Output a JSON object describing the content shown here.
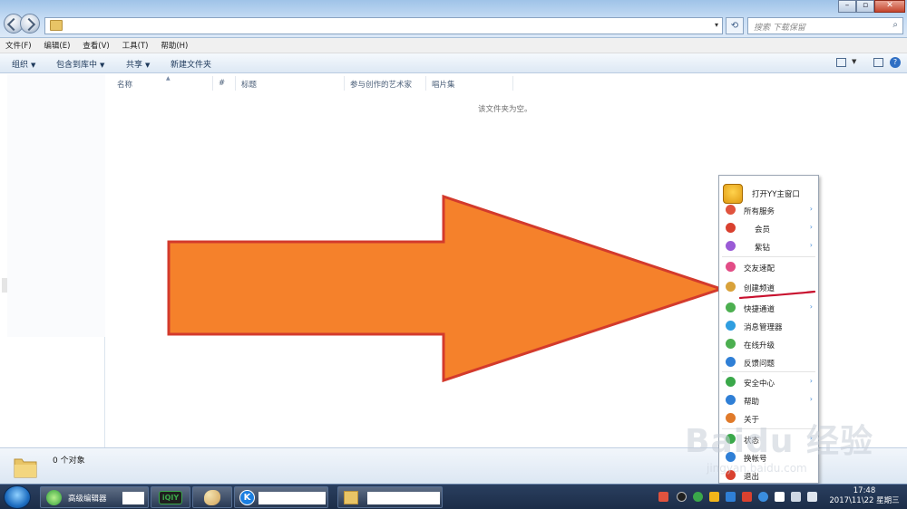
{
  "search": {
    "placeholder": "搜索 下载保留"
  },
  "menubar": {
    "items": [
      "文件(F)",
      "编辑(E)",
      "查看(V)",
      "工具(T)",
      "帮助(H)"
    ]
  },
  "toolbar": {
    "organize": "组织",
    "include_in_library": "包含到库中",
    "share": "共享",
    "new_folder": "新建文件夹"
  },
  "columns": [
    "名称",
    "#",
    "标题",
    "参与创作的艺术家",
    "唱片集"
  ],
  "empty_message": "该文件夹为空。",
  "status": {
    "count": "0 个对象"
  },
  "taskbar": {
    "buttons": [
      {
        "label": "高级编辑器",
        "icon": "browser-icon"
      },
      {
        "label": "",
        "icon": "iqiyi-icon"
      },
      {
        "label": "",
        "icon": "paint-icon"
      },
      {
        "label": "",
        "icon": "kugou-icon"
      },
      {
        "label": "",
        "icon": "folder-icon"
      }
    ],
    "clock_time": "17:48",
    "clock_date": "2017\\11\\22 星期三"
  },
  "context_menu": {
    "header": "打开YY主窗口",
    "items": [
      {
        "label": "所有服务",
        "submenu": true,
        "icon": "heart-icon",
        "color": "#e0533e"
      },
      {
        "label": "会员",
        "submenu": true,
        "icon": "vip-icon",
        "color": "#d9412f"
      },
      {
        "label": "紫钻",
        "submenu": true,
        "icon": "diamond-icon",
        "color": "#9a5bd6"
      },
      {
        "label": "交友速配",
        "submenu": false,
        "icon": "match-icon",
        "color": "#e24d86"
      },
      {
        "label": "创建频道",
        "submenu": false,
        "icon": "house-icon",
        "color": "#d9a23a"
      },
      {
        "label": "快捷通道",
        "submenu": true,
        "icon": "shortcut-icon",
        "color": "#4caf50"
      },
      {
        "label": "消息管理器",
        "submenu": false,
        "icon": "message-icon",
        "color": "#2f9ee0"
      },
      {
        "label": "在线升级",
        "submenu": false,
        "icon": "upgrade-icon",
        "color": "#4caf50"
      },
      {
        "label": "反馈问题",
        "submenu": false,
        "icon": "feedback-icon",
        "color": "#2f7fd6"
      },
      {
        "label": "安全中心",
        "submenu": true,
        "icon": "shield-icon",
        "color": "#3aa84a"
      },
      {
        "label": "帮助",
        "submenu": true,
        "icon": "help-icon",
        "color": "#2f7fd6"
      },
      {
        "label": "关于",
        "submenu": false,
        "icon": "about-icon",
        "color": "#e07a2a"
      },
      {
        "label": "状态",
        "submenu": true,
        "icon": "status-icon",
        "color": "#3aa84a"
      },
      {
        "label": "换帐号",
        "submenu": false,
        "icon": "switch-account-icon",
        "color": "#2f7fd6"
      },
      {
        "label": "退出",
        "submenu": false,
        "icon": "exit-icon",
        "color": "#d9412f"
      }
    ]
  },
  "annotation": {
    "arrow_color": "#f5812b",
    "arrow_border": "#d33a2c",
    "underline_color": "#c8102e"
  },
  "watermark": {
    "brand": "Baidu 经验",
    "url": "jingyan.baidu.com"
  }
}
